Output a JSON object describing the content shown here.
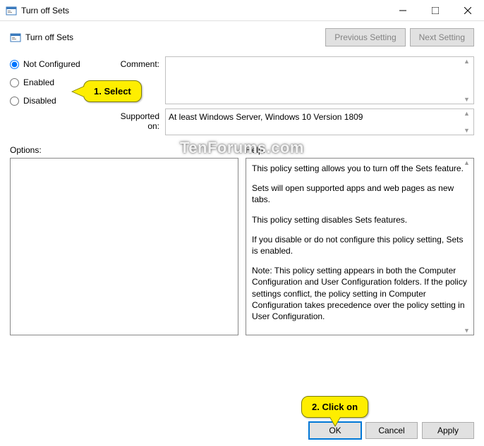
{
  "titlebar": {
    "title": "Turn off Sets"
  },
  "header": {
    "title": "Turn off Sets"
  },
  "nav": {
    "prev": "Previous Setting",
    "next": "Next Setting"
  },
  "radios": {
    "not_configured": "Not Configured",
    "enabled": "Enabled",
    "disabled": "Disabled"
  },
  "labels": {
    "comment": "Comment:",
    "supported": "Supported on:",
    "options": "Options:",
    "help": "Help:"
  },
  "supported_text": "At least Windows Server, Windows 10 Version 1809",
  "help": {
    "p1": "This policy setting allows you to turn off the Sets feature.",
    "p2": "Sets will open supported apps and web pages as new tabs.",
    "p3": "This policy setting disables Sets features.",
    "p4": "If you disable or do not configure this policy setting, Sets is enabled.",
    "p5": "Note: This policy setting appears in both the Computer Configuration and User Configuration folders. If the policy settings conflict, the policy setting in Computer Configuration takes precedence over the policy setting in User Configuration."
  },
  "buttons": {
    "ok": "OK",
    "cancel": "Cancel",
    "apply": "Apply"
  },
  "callouts": {
    "c1": "1. Select",
    "c2": "2. Click on"
  },
  "watermark": "TenForums.com"
}
